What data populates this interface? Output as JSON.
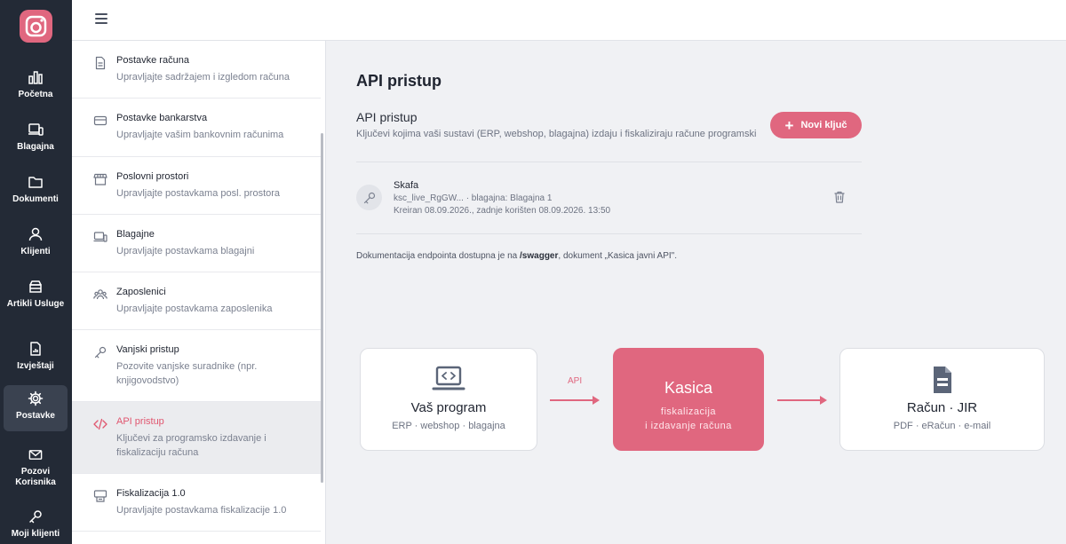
{
  "rail": {
    "items": [
      {
        "label": "Početna",
        "icon": "bar-chart-icon"
      },
      {
        "label": "Blagajna",
        "icon": "pos-device-icon"
      },
      {
        "label": "Dokumenti",
        "icon": "folder-icon"
      },
      {
        "label": "Klijenti",
        "icon": "users-icon"
      },
      {
        "label": "Artikli Usluge",
        "icon": "archive-icon"
      },
      {
        "label": "Izvještaji",
        "icon": "report-icon"
      },
      {
        "label": "Postavke",
        "icon": "gear-icon"
      },
      {
        "label": "Pozovi Korisnika",
        "icon": "mail-icon"
      },
      {
        "label": "Moji klijenti",
        "icon": "key-icon"
      }
    ],
    "active": "Postavke"
  },
  "settings": {
    "items": [
      {
        "title": "Postavke računa",
        "desc": "Upravljajte sadržajem i izgledom računa",
        "icon": "document-icon"
      },
      {
        "title": "Postavke bankarstva",
        "desc": "Upravljajte vašim bankovnim računima",
        "icon": "credit-card-icon"
      },
      {
        "title": "Poslovni prostori",
        "desc": "Upravljajte postavkama posl. prostora",
        "icon": "store-icon"
      },
      {
        "title": "Blagajne",
        "desc": "Upravljajte postavkama blagajni",
        "icon": "devices-icon"
      },
      {
        "title": "Zaposlenici",
        "desc": "Upravljajte postavkama zaposlenika",
        "icon": "team-icon"
      },
      {
        "title": "Vanjski pristup",
        "desc": "Pozovite vanjske suradnike (npr. knjigovodstvo)",
        "icon": "key-icon"
      },
      {
        "title": "API pristup",
        "desc": "Ključevi za programsko izdavanje i fiskalizaciju računa",
        "icon": "code-icon"
      },
      {
        "title": "Fiskalizacija 1.0",
        "desc": "Upravljajte postavkama fiskalizacije 1.0",
        "icon": "printer-icon"
      }
    ],
    "active": "API pristup"
  },
  "main": {
    "page_title": "API pristup",
    "section_title": "API pristup",
    "section_subtitle": "Ključevi kojima vaši sustavi (ERP, webshop, blagajna) izdaju i fiskaliziraju račune programski",
    "new_key_label": "Novi ključ",
    "key": {
      "name": "Skafa",
      "meta": "ksc_live_RgGW... · blagajna: Blagajna 1",
      "created": "Kreiran 08.09.2026., zadnje korišten 08.09.2026. 13:50"
    },
    "doc_prefix": "Dokumentacija endpointa dostupna je na ",
    "doc_path": "/swagger",
    "doc_suffix": ", dokument „Kasica javni API\".",
    "flow": {
      "left_title": "Vaš program",
      "left_sub": "ERP · webshop · blagajna",
      "api_label": "API",
      "center_title": "Kasica",
      "center_sub1": "fiskalizacija",
      "center_sub2": "i izdavanje računa",
      "right_title": "Račun · JIR",
      "right_sub": "PDF · eRačun · e-mail"
    }
  },
  "colors": {
    "accent": "#e0677f",
    "rail": "#232a36",
    "background": "#f0f1f4"
  }
}
